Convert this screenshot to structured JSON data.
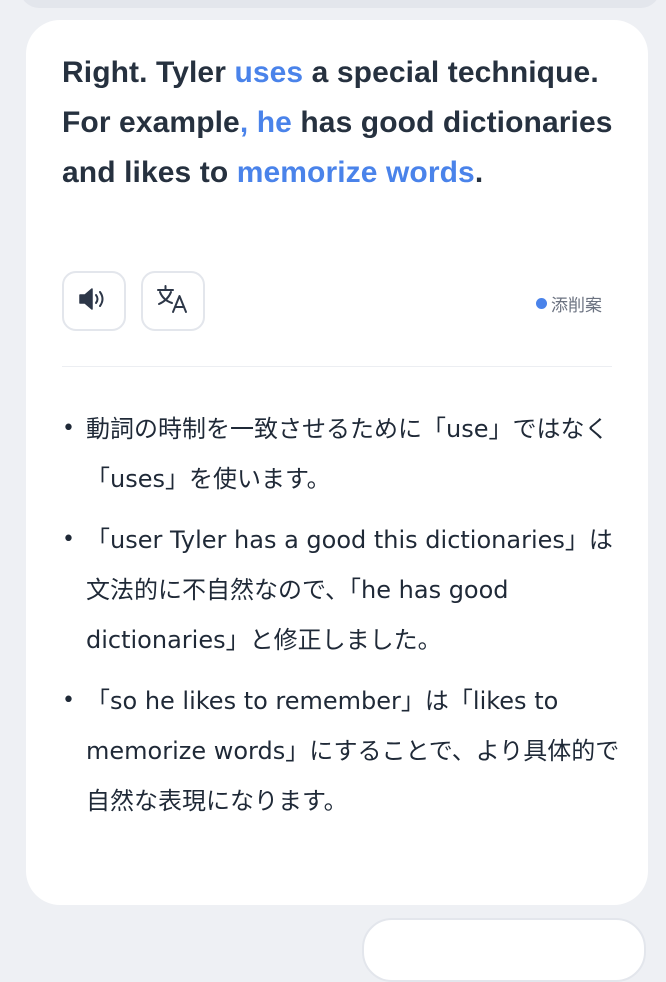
{
  "sentence": {
    "segments": [
      {
        "text": "Right. Tyler ",
        "highlight": false
      },
      {
        "text": "uses",
        "highlight": true
      },
      {
        "text": " a special technique. For example",
        "highlight": false
      },
      {
        "text": ", he",
        "highlight": true
      },
      {
        "text": " has good dictionaries and likes to ",
        "highlight": false
      },
      {
        "text": "memorize words",
        "highlight": true
      },
      {
        "text": ".",
        "highlight": false
      }
    ]
  },
  "controls": {
    "speaker_icon": "speaker-icon",
    "translate_icon": "translate-icon"
  },
  "correction": {
    "label": "添削案",
    "dot_color": "#4a83ea"
  },
  "notes": [
    "動詞の時制を一致させるために「use」ではなく「uses」を使います。",
    "「user Tyler has a good this dictionaries」は文法的に不自然なので、「he has good dictionaries」と修正しました。",
    "「so he likes to remember」は「likes to memorize words」にすることで、より具体的で自然な表現になります。"
  ],
  "colors": {
    "accent": "#4a83ea",
    "text": "#26313f",
    "background": "#eef0f4",
    "card": "#ffffff"
  }
}
